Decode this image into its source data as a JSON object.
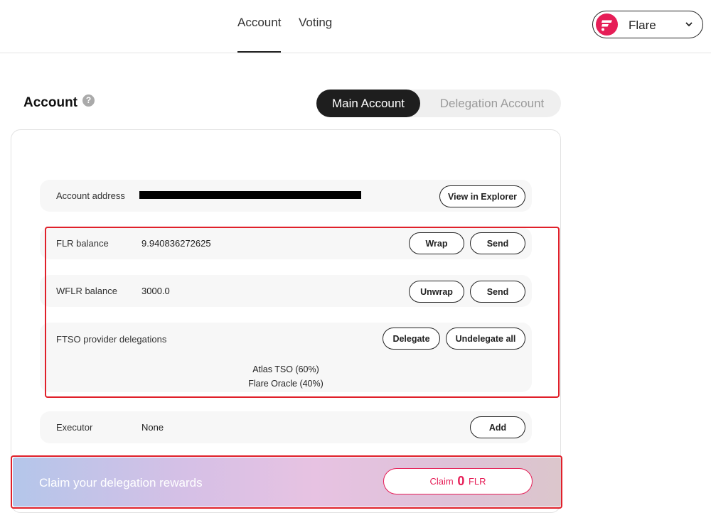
{
  "nav": {
    "tabs": [
      {
        "label": "Account"
      },
      {
        "label": "Voting"
      }
    ]
  },
  "network": {
    "name": "Flare",
    "icon": "flare-logo-icon",
    "color": "#e61e57"
  },
  "section": {
    "title": "Account",
    "help_glyph": "?"
  },
  "toggle": {
    "main_label": "Main Account",
    "delegation_label": "Delegation Account"
  },
  "rows": {
    "address": {
      "label": "Account address",
      "button": "View in Explorer"
    },
    "flr": {
      "label": "FLR balance",
      "value": "9.940836272625",
      "buttons": [
        "Wrap",
        "Send"
      ]
    },
    "wflr": {
      "label": "WFLR balance",
      "value": "3000.0",
      "buttons": [
        "Unwrap",
        "Send"
      ]
    },
    "ftso": {
      "label": "FTSO provider delegations",
      "buttons": [
        "Delegate",
        "Undelegate all"
      ],
      "delegations": [
        "Atlas TSO (60%)",
        "Flare Oracle (40%)"
      ]
    },
    "executor": {
      "label": "Executor",
      "value": "None",
      "button": "Add"
    }
  },
  "claim": {
    "text": "Claim your delegation rewards",
    "button_prefix": "Claim",
    "amount": "0",
    "unit": "FLR",
    "accent_color": "#e61e57"
  }
}
